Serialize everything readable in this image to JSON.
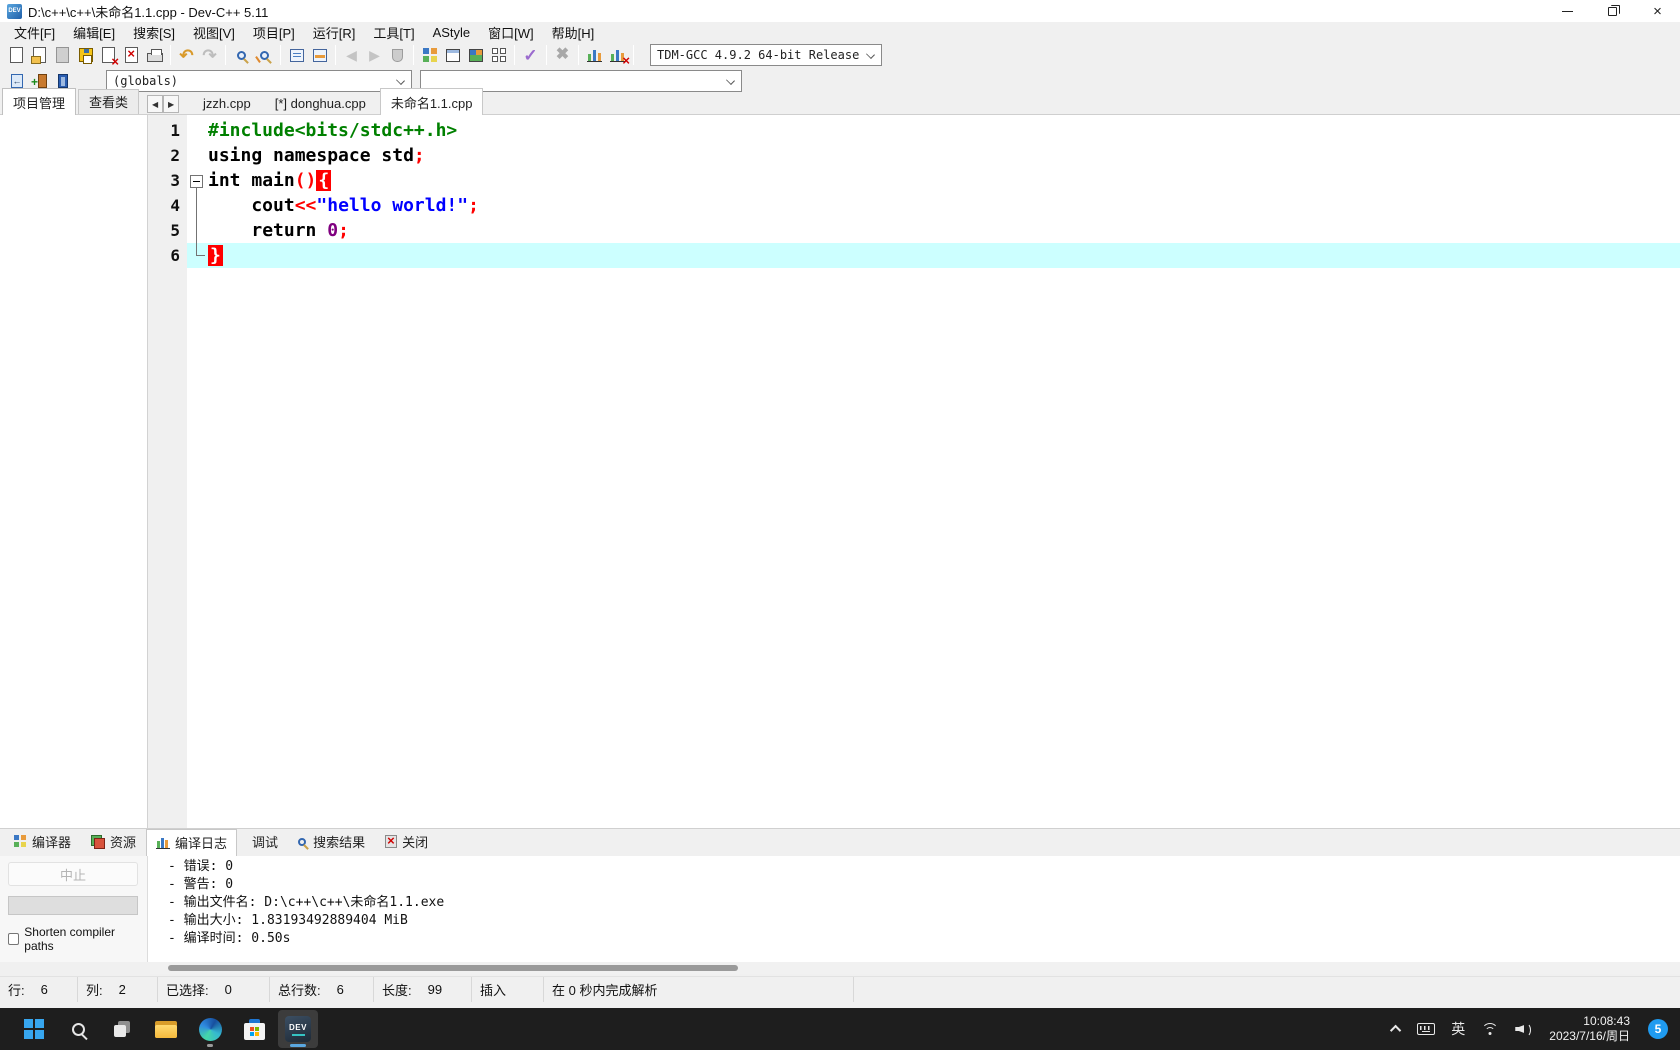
{
  "window": {
    "title": "D:\\c++\\c++\\未命名1.1.cpp - Dev-C++ 5.11"
  },
  "menu": {
    "items": [
      "文件[F]",
      "编辑[E]",
      "搜索[S]",
      "视图[V]",
      "项目[P]",
      "运行[R]",
      "工具[T]",
      "AStyle",
      "窗口[W]",
      "帮助[H]"
    ]
  },
  "toolbar": {
    "compiler_select": "TDM-GCC 4.9.2 64-bit Release",
    "globals_select": "(globals)",
    "members_select": ""
  },
  "left_panel": {
    "tabs": [
      {
        "label": "项目管理",
        "active": true
      },
      {
        "label": "查看类",
        "active": false
      }
    ]
  },
  "editor": {
    "tabs": [
      {
        "label": "jzzh.cpp",
        "active": false
      },
      {
        "label": "[*] donghua.cpp",
        "active": false
      },
      {
        "label": "未命名1.1.cpp",
        "active": true
      }
    ],
    "lines": [
      {
        "num": "1",
        "fold": "",
        "current": false,
        "tokens": [
          {
            "t": "#include<bits/stdc++.h>",
            "c": "pp"
          }
        ]
      },
      {
        "num": "2",
        "fold": "",
        "current": false,
        "tokens": [
          {
            "t": "using namespace",
            "c": "kw"
          },
          {
            "t": " std",
            "c": "id"
          },
          {
            "t": ";",
            "c": "sym"
          }
        ]
      },
      {
        "num": "3",
        "fold": "box",
        "current": false,
        "tokens": [
          {
            "t": "int",
            "c": "kw"
          },
          {
            "t": " main",
            "c": "id"
          },
          {
            "t": "()",
            "c": "sym"
          },
          {
            "t": "{",
            "c": "brace"
          }
        ]
      },
      {
        "num": "4",
        "fold": "line",
        "current": false,
        "tokens": [
          {
            "t": "    cout",
            "c": "id"
          },
          {
            "t": "<<",
            "c": "sym"
          },
          {
            "t": "\"hello world!\"",
            "c": "str"
          },
          {
            "t": ";",
            "c": "sym"
          }
        ]
      },
      {
        "num": "5",
        "fold": "line",
        "current": false,
        "tokens": [
          {
            "t": "    ",
            "c": "id"
          },
          {
            "t": "return",
            "c": "kw"
          },
          {
            "t": " ",
            "c": "id"
          },
          {
            "t": "0",
            "c": "num"
          },
          {
            "t": ";",
            "c": "sym"
          }
        ]
      },
      {
        "num": "6",
        "fold": "corner",
        "current": true,
        "tokens": [
          {
            "t": "}",
            "c": "brace"
          }
        ]
      }
    ]
  },
  "bottom_panel": {
    "tabs": [
      {
        "label": "编译器",
        "icon": "grid",
        "active": false
      },
      {
        "label": "资源",
        "icon": "layers",
        "active": false
      },
      {
        "label": "编译日志",
        "icon": "chart",
        "active": true
      },
      {
        "label": "调试",
        "icon": "check",
        "active": false
      },
      {
        "label": "搜索结果",
        "icon": "mag",
        "active": false
      },
      {
        "label": "关闭",
        "icon": "closex",
        "active": false
      }
    ],
    "abort_button": "中止",
    "shorten_compiler_paths": "Shorten compiler paths",
    "log_lines": [
      "- 错误: 0",
      "- 警告: 0",
      "- 输出文件名: D:\\c++\\c++\\未命名1.1.exe",
      "- 输出大小: 1.83193492889404 MiB",
      "- 编译时间: 0.50s"
    ]
  },
  "status_bar": {
    "panels": [
      {
        "label": "行:",
        "value": "6"
      },
      {
        "label": "列:",
        "value": "2"
      },
      {
        "label": "已选择:",
        "value": "0"
      },
      {
        "label": "总行数:",
        "value": "6"
      },
      {
        "label": "长度:",
        "value": "99"
      },
      {
        "label": "插入",
        "value": ""
      },
      {
        "label": "在 0 秒内完成解析",
        "value": ""
      }
    ]
  },
  "taskbar": {
    "ime": "英",
    "time": "10:08:43",
    "date": "2023/7/16/周日",
    "badge": "5"
  },
  "colors": {
    "preprocessor": "#008000",
    "keyword": "#000000",
    "identifier": "#000000",
    "string": "#0000ff",
    "number": "#800080",
    "symbol": "#ff0000",
    "brace_highlight_bg": "#ff0000",
    "brace_highlight_fg": "#ffffff",
    "current_line_bg": "#ccffff",
    "badge_bg": "#1f9bf0",
    "taskbar_bg": "#1e1e1e"
  }
}
